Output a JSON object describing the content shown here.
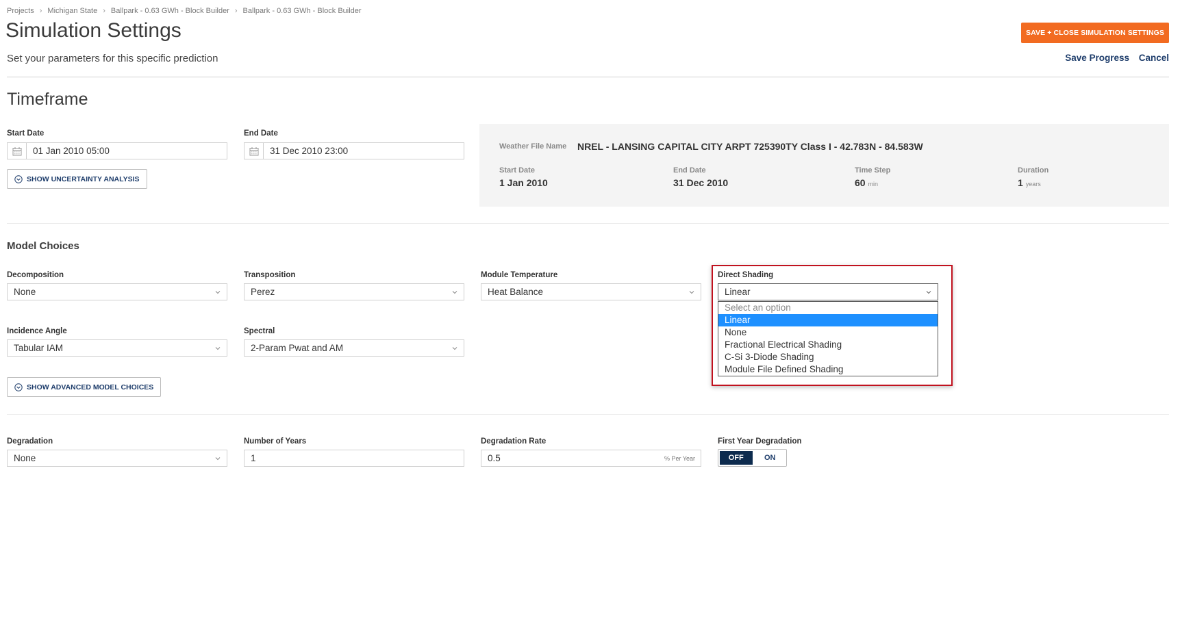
{
  "breadcrumb": {
    "items": [
      "Projects",
      "Michigan State",
      "Ballpark - 0.63 GWh - Block Builder",
      "Ballpark - 0.63 GWh - Block Builder"
    ]
  },
  "header": {
    "title": "Simulation Settings",
    "subtitle": "Set your parameters for this specific prediction",
    "primary_button": "SAVE + CLOSE SIMULATION SETTINGS",
    "save_progress": "Save Progress",
    "cancel": "Cancel",
    "accent_color": "#f26b21"
  },
  "timeframe": {
    "title": "Timeframe",
    "start_label": "Start Date",
    "start_value": "01 Jan 2010 05:00",
    "end_label": "End Date",
    "end_value": "31 Dec 2010 23:00",
    "uncertainty_button": "SHOW UNCERTAINTY ANALYSIS",
    "weather": {
      "file_label": "Weather File Name",
      "file_value": "NREL - LANSING CAPITAL CITY ARPT 725390TY Class I - 42.783N - 84.583W",
      "start_label": "Start Date",
      "start_value": "1 Jan 2010",
      "end_label": "End Date",
      "end_value": "31 Dec 2010",
      "timestep_label": "Time Step",
      "timestep_value": "60",
      "timestep_unit": "min",
      "duration_label": "Duration",
      "duration_value": "1",
      "duration_unit": "years"
    }
  },
  "model_choices": {
    "title": "Model Choices",
    "decomposition": {
      "label": "Decomposition",
      "value": "None"
    },
    "transposition": {
      "label": "Transposition",
      "value": "Perez"
    },
    "module_temperature": {
      "label": "Module Temperature",
      "value": "Heat Balance"
    },
    "direct_shading": {
      "label": "Direct Shading",
      "value": "Linear",
      "options": [
        "Select an option",
        "Linear",
        "None",
        "Fractional Electrical Shading",
        "C-Si 3-Diode Shading",
        "Module File Defined Shading"
      ],
      "selected_index": 1
    },
    "incidence_angle": {
      "label": "Incidence Angle",
      "value": "Tabular IAM"
    },
    "spectral": {
      "label": "Spectral",
      "value": "2-Param Pwat and AM"
    },
    "advanced_button": "SHOW ADVANCED MODEL CHOICES"
  },
  "degradation": {
    "degradation": {
      "label": "Degradation",
      "value": "None"
    },
    "years": {
      "label": "Number of Years",
      "value": "1"
    },
    "rate": {
      "label": "Degradation Rate",
      "value": "0.5",
      "unit": "% Per Year"
    },
    "first_year": {
      "label": "First Year Degradation",
      "off": "OFF",
      "on": "ON",
      "active": "OFF"
    }
  }
}
